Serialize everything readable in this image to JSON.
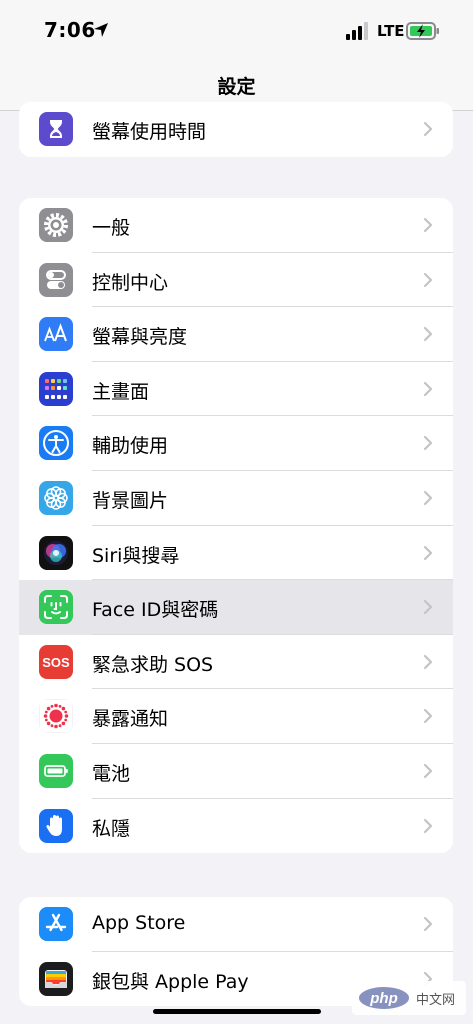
{
  "status_bar": {
    "time": "7:06",
    "network": "LTE"
  },
  "nav": {
    "title": "設定"
  },
  "group_top": [
    {
      "label": "螢幕使用時間",
      "icon": "hourglass-icon",
      "color": "#5c4ccd"
    }
  ],
  "group_main": [
    {
      "label": "一般",
      "icon": "gear-icon",
      "color": "#8e8e93"
    },
    {
      "label": "控制中心",
      "icon": "toggles-icon",
      "color": "#8e8e93"
    },
    {
      "label": "螢幕與亮度",
      "icon": "text-size-icon",
      "color": "#2f7cf6"
    },
    {
      "label": "主畫面",
      "icon": "home-grid-icon",
      "color": "#2a3fd0"
    },
    {
      "label": "輔助使用",
      "icon": "accessibility-icon",
      "color": "#1a7cf5"
    },
    {
      "label": "背景圖片",
      "icon": "flower-icon",
      "color": "#35a7e8"
    },
    {
      "label": "Siri與搜尋",
      "icon": "siri-icon",
      "color": "#111111"
    },
    {
      "label": "Face ID與密碼",
      "icon": "face-id-icon",
      "color": "#34c759"
    },
    {
      "label": "緊急求助 SOS",
      "icon": "sos-icon",
      "color": "#e73c34"
    },
    {
      "label": "暴露通知",
      "icon": "exposure-icon",
      "color": "#ffffff"
    },
    {
      "label": "電池",
      "icon": "battery-icon",
      "color": "#34c759"
    },
    {
      "label": "私隱",
      "icon": "hand-icon",
      "color": "#1a6ff2"
    }
  ],
  "group_bottom": [
    {
      "label": "App Store",
      "icon": "app-store-icon",
      "color": "#1c8cf8"
    },
    {
      "label": "銀包與 Apple Pay",
      "icon": "wallet-icon",
      "color": "#1c1c1e"
    }
  ],
  "sos_badge": "SOS",
  "watermark": {
    "logo": "php",
    "text": "中文网"
  },
  "highlighted_row": "Face ID與密碼"
}
